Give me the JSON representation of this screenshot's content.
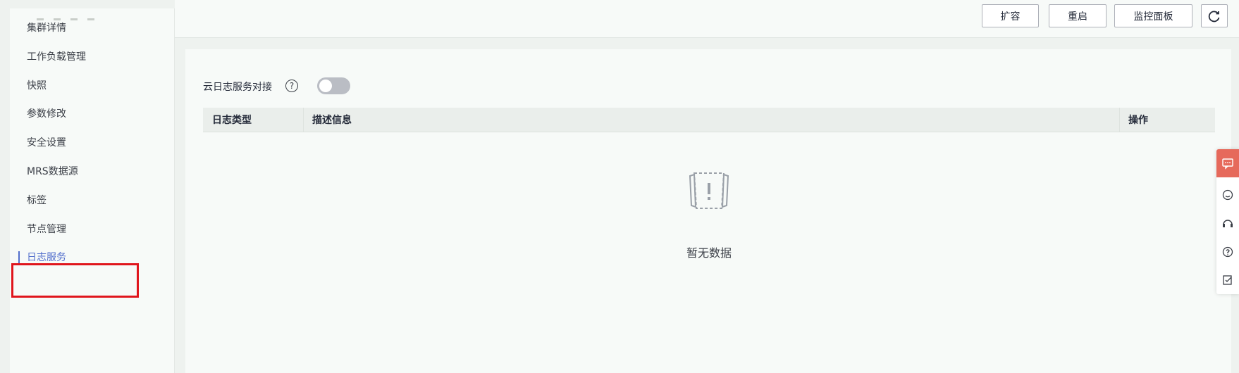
{
  "toolbar": {
    "expand_label": "扩容",
    "restart_label": "重启",
    "monitor_label": "监控面板",
    "refresh_icon": "refresh-icon"
  },
  "sidebar": {
    "items": [
      {
        "label": "集群详情"
      },
      {
        "label": "工作负载管理"
      },
      {
        "label": "快照"
      },
      {
        "label": "参数修改"
      },
      {
        "label": "安全设置"
      },
      {
        "label": "MRS数据源"
      },
      {
        "label": "标签"
      },
      {
        "label": "节点管理"
      },
      {
        "label": "日志服务",
        "active": true
      }
    ]
  },
  "log_service": {
    "label": "云日志服务对接",
    "toggle_on": false
  },
  "table": {
    "columns": [
      "日志类型",
      "描述信息",
      "操作"
    ],
    "rows": [],
    "empty_text": "暂无数据"
  },
  "colors": {
    "accent": "#526ecc",
    "highlight": "#e0151c",
    "chat_button": "#e6695b"
  },
  "float_tools": [
    "chat-icon",
    "feedback-icon",
    "support-icon",
    "help-icon",
    "survey-icon"
  ]
}
